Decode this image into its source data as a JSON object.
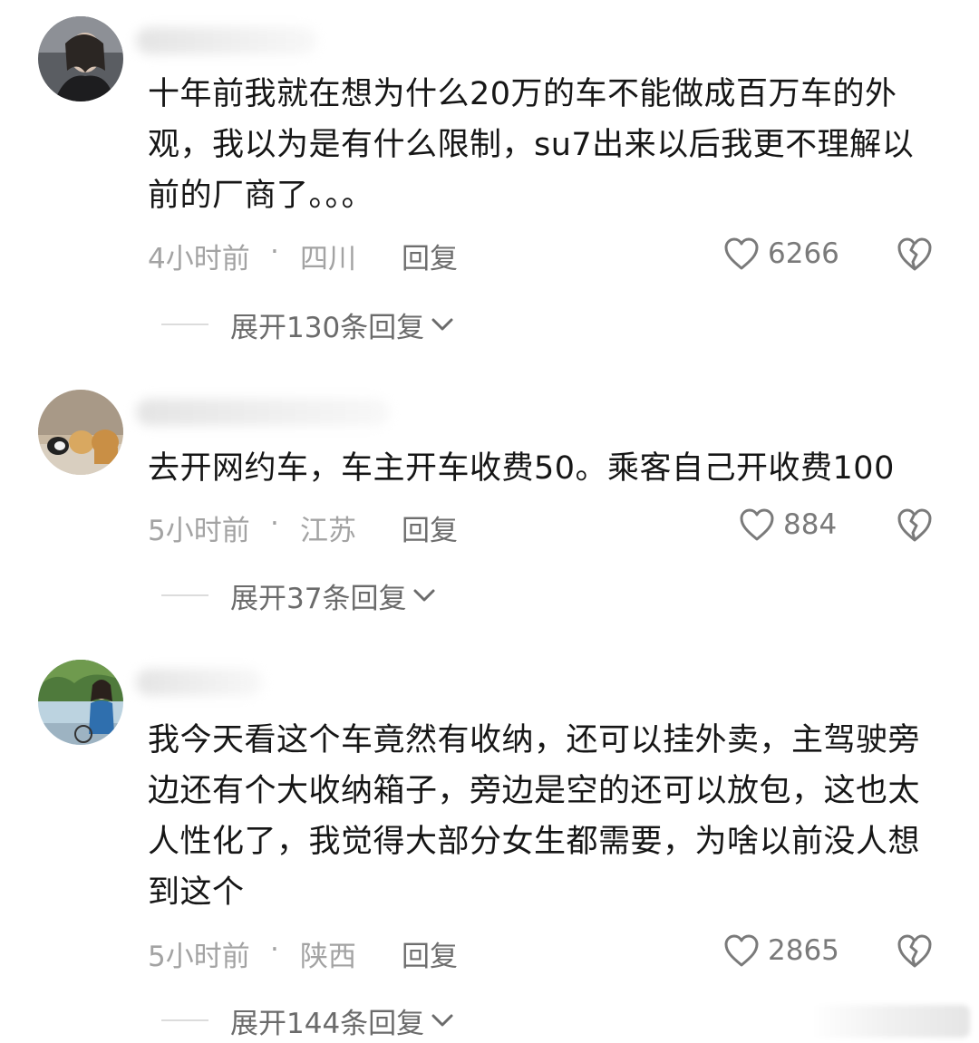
{
  "comments": [
    {
      "text": "十年前我就在想为什么20万的车不能做成百万车的外观，我以为是有什么限制，su7出来以后我更不理解以前的厂商了。。。",
      "time": "4小时前",
      "separator": "·",
      "location": "四川",
      "reply_label": "回复",
      "likes": "6266",
      "expand_label": "展开130条回复"
    },
    {
      "text": "去开网约车，车主开车收费50。乘客自己开收费100",
      "time": "5小时前",
      "separator": "·",
      "location": "江苏",
      "reply_label": "回复",
      "likes": "884",
      "expand_label": "展开37条回复"
    },
    {
      "text": "我今天看这个车竟然有收纳，还可以挂外卖，主驾驶旁边还有个大收纳箱子，旁边是空的还可以放包，这也太人性化了，我觉得大部分女生都需要，为啥以前没人想到这个",
      "time": "5小时前",
      "separator": "·",
      "location": "陕西",
      "reply_label": "回复",
      "likes": "2865",
      "expand_label": "展开144条回复"
    }
  ],
  "icons": {
    "like": "heart-outline-icon",
    "dislike": "broken-heart-icon",
    "expand": "chevron-down-icon"
  },
  "colors": {
    "text": "#161616",
    "meta": "#a3a3a3",
    "reply": "#6e6e6e",
    "icon": "#7a7a7a"
  }
}
